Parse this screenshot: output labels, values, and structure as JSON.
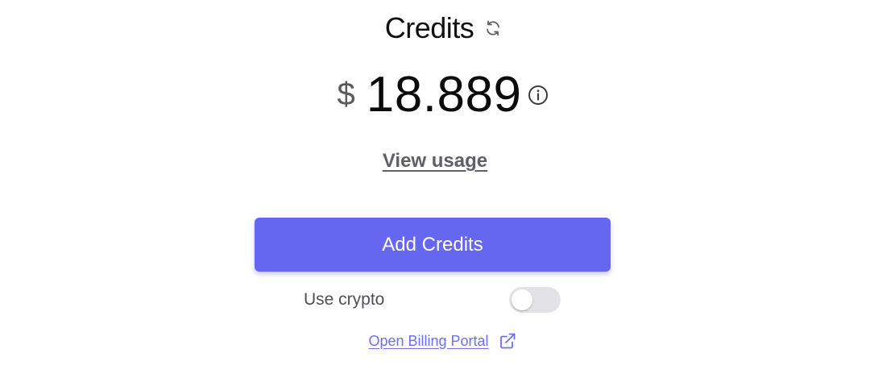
{
  "header": {
    "title": "Credits",
    "refresh_icon": "refresh-icon"
  },
  "balance": {
    "currency_symbol": "$",
    "amount": "18.889",
    "info_icon": "info-icon"
  },
  "links": {
    "view_usage": "View usage",
    "billing_portal": "Open Billing Portal",
    "billing_icon": "external-link-icon"
  },
  "actions": {
    "add_credits_label": "Add Credits"
  },
  "crypto": {
    "label": "Use crypto",
    "enabled": false
  },
  "colors": {
    "accent": "#6567f1",
    "link": "#6d6ff0",
    "toggle_off": "#e3e3e7"
  }
}
